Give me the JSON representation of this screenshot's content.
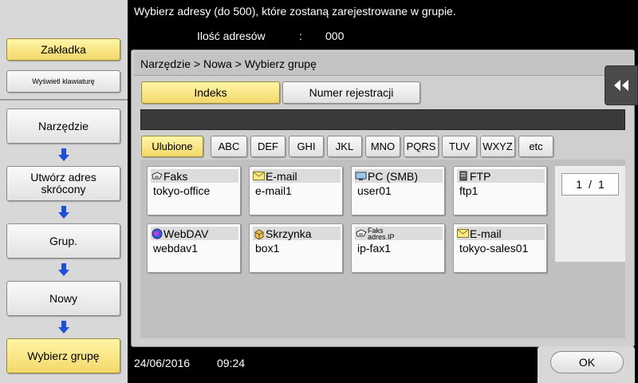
{
  "header": {
    "message": "Wybierz adresy (do 500), które zostaną zarejestrowane w grupie.",
    "count_label": "Ilość adresów",
    "count_colon": ":",
    "count_value": "000"
  },
  "sidebar": {
    "bookmark_label": "Zakładka",
    "keyboard_label": "Wyświetl klawiaturę",
    "steps": [
      "Narzędzie",
      "Utwórz adres skrócony",
      "Grup.",
      "Nowy",
      "Wybierz grupę"
    ]
  },
  "breadcrumb": "Narzędzie > Nowa > Wybierz grupę",
  "tabs": [
    "Indeks",
    "Numer rejestracji"
  ],
  "index_filters": [
    "Ulubione",
    "ABC",
    "DEF",
    "GHI",
    "JKL",
    "MNO",
    "PQRS",
    "TUV",
    "WXYZ",
    "etc"
  ],
  "entries": [
    {
      "type": "Faks",
      "name": "tokyo-office",
      "icon": "fax-icon"
    },
    {
      "type": "E-mail",
      "name": "e-mail1",
      "icon": "email-icon"
    },
    {
      "type": "PC (SMB)",
      "name": "user01",
      "icon": "pc-icon"
    },
    {
      "type": "FTP",
      "name": "ftp1",
      "icon": "ftp-icon"
    },
    {
      "type": "WebDAV",
      "name": "webdav1",
      "icon": "webdav-icon"
    },
    {
      "type": "Skrzynka",
      "name": "box1",
      "icon": "box-icon"
    },
    {
      "type_line1": "Faks",
      "type_line2": "adres.IP",
      "name": "ip-fax1",
      "icon": "ip-fax-icon"
    },
    {
      "type": "E-mail",
      "name": "tokyo-sales01",
      "icon": "email-icon"
    }
  ],
  "pager": {
    "current": "1",
    "separator": "/",
    "total": "1"
  },
  "collapse_icon": "double-left-arrow-icon",
  "status": {
    "date": "24/06/2016",
    "time": "09:24"
  },
  "ok_label": "OK",
  "colors": {
    "selected": "#f3d86a",
    "panel": "#cfcfcf",
    "background": "#000000"
  }
}
